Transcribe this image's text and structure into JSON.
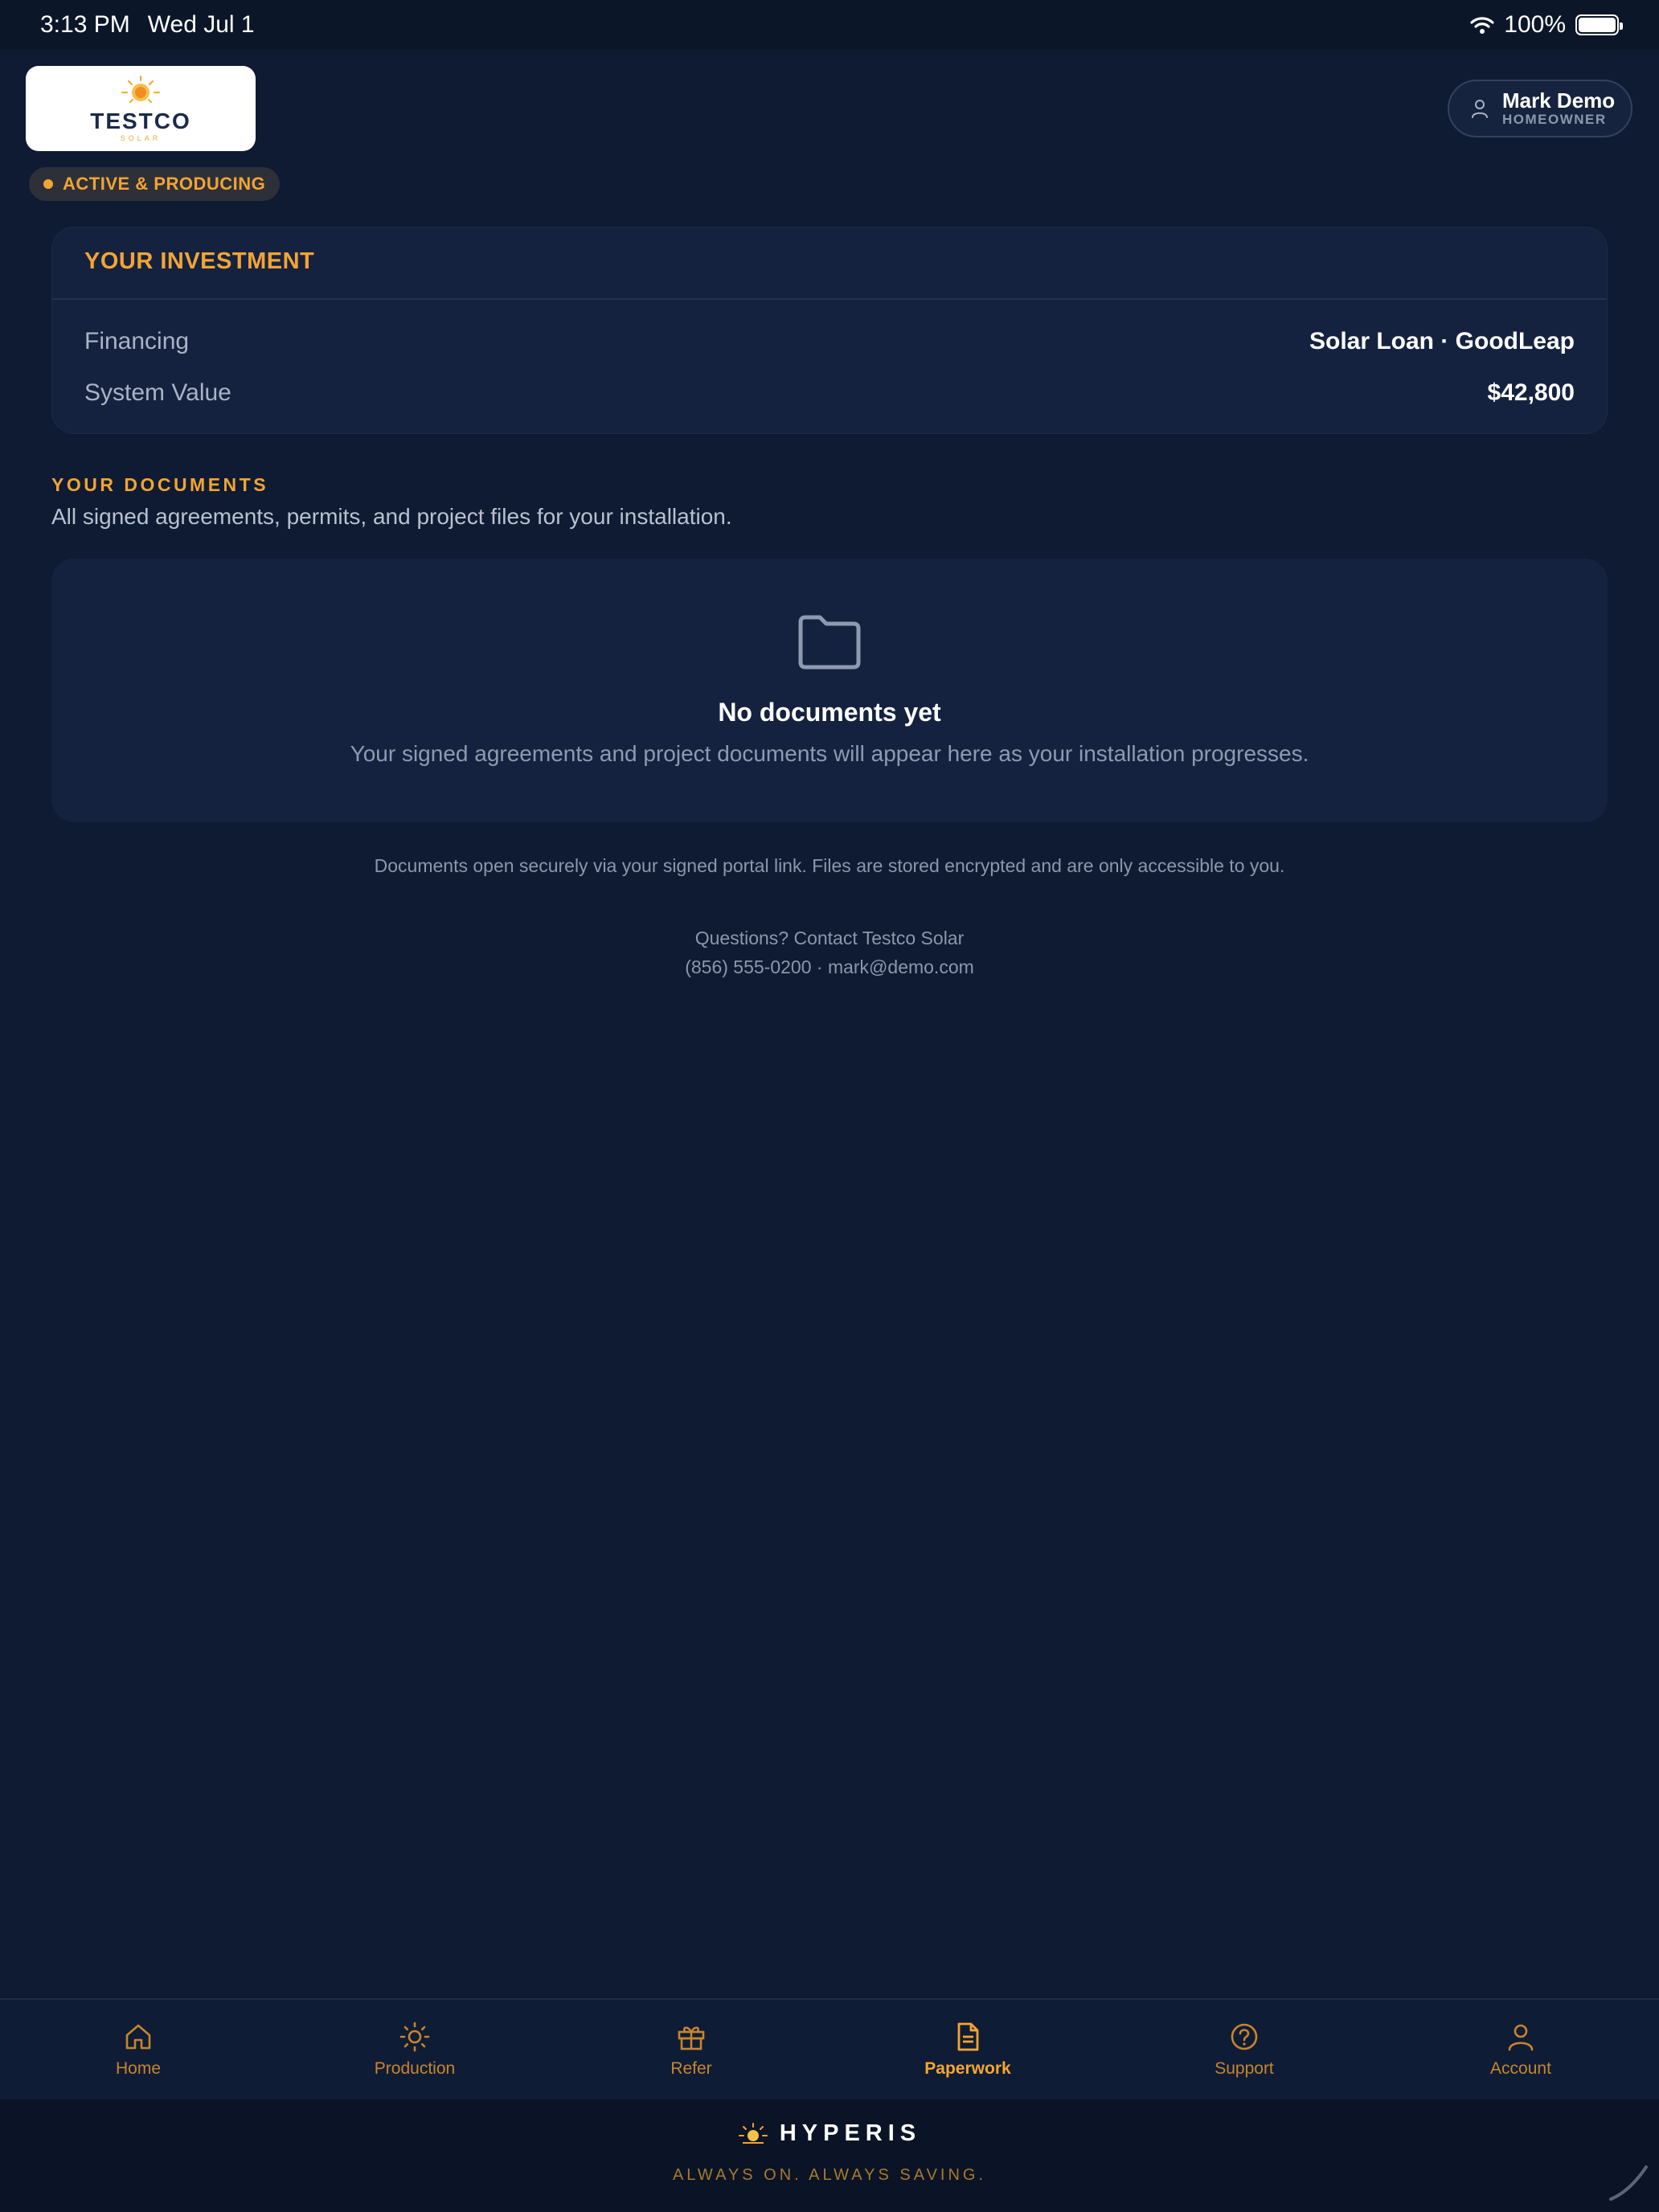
{
  "status_bar": {
    "time": "3:13 PM",
    "date": "Wed Jul 1",
    "battery": "100%"
  },
  "header": {
    "logo_text": "TESTCO",
    "logo_sub": "SOLAR",
    "status_badge": "ACTIVE & PRODUCING",
    "user_name": "Mark Demo",
    "user_role": "HOMEOWNER"
  },
  "investment": {
    "title": "YOUR INVESTMENT",
    "rows": [
      {
        "label": "Financing",
        "value": "Solar Loan · GoodLeap"
      },
      {
        "label": "System Value",
        "value": "$42,800"
      }
    ]
  },
  "documents": {
    "heading": "YOUR DOCUMENTS",
    "subheading": "All signed agreements, permits, and project files for your installation.",
    "empty_title": "No documents yet",
    "empty_message": "Your signed agreements and project documents will appear here as your installation progresses.",
    "secure_note": "Documents open securely via your signed portal link. Files are stored encrypted and are only accessible to you.",
    "contact_question": "Questions? Contact Testco Solar",
    "contact_details": "(856) 555-0200 · mark@demo.com"
  },
  "tabs": [
    {
      "label": "Home",
      "icon": "home-icon"
    },
    {
      "label": "Production",
      "icon": "sun-icon"
    },
    {
      "label": "Refer",
      "icon": "gift-icon"
    },
    {
      "label": "Paperwork",
      "icon": "document-icon",
      "active": true
    },
    {
      "label": "Support",
      "icon": "help-circle-icon"
    },
    {
      "label": "Account",
      "icon": "user-icon"
    }
  ],
  "footer": {
    "brand": "HYPERIS",
    "tagline": "ALWAYS ON. ALWAYS SAVING."
  },
  "colors": {
    "background": "#0e1b33",
    "card": "#15223f",
    "accent": "#f2a434"
  }
}
